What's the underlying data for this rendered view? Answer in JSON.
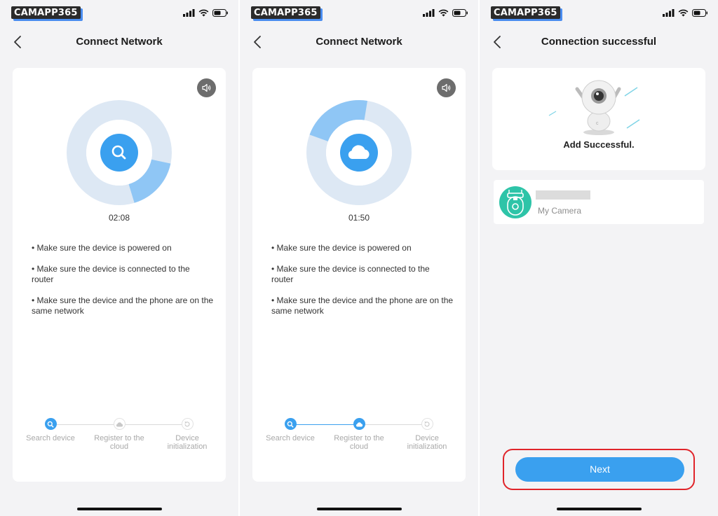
{
  "watermark": "CAMAPP365",
  "screen1": {
    "title": "Connect Network",
    "timer": "02:08",
    "center_icon": "search-icon",
    "progress_fraction": 0.17,
    "tips": [
      "• Make sure the device is powered on",
      "• Make sure the device is connected to the router",
      "• Make sure the device and the phone are on the same network"
    ],
    "steps": [
      {
        "label": "Search device",
        "icon": "search-icon",
        "state": "active"
      },
      {
        "label": "Register to the cloud",
        "icon": "cloud-icon",
        "state": "idle"
      },
      {
        "label": "Device initialization",
        "icon": "refresh-icon",
        "state": "idle"
      }
    ]
  },
  "screen2": {
    "title": "Connect Network",
    "timer": "01:50",
    "center_icon": "cloud-icon",
    "progress_fraction": 0.22,
    "tips": [
      "• Make sure the device is powered on",
      "• Make sure the device is connected to the router",
      "• Make sure the device and the phone are on the same network"
    ],
    "steps": [
      {
        "label": "Search device",
        "icon": "search-icon",
        "state": "active"
      },
      {
        "label": "Register to the cloud",
        "icon": "cloud-icon",
        "state": "active"
      },
      {
        "label": "Device initialization",
        "icon": "refresh-icon",
        "state": "idle"
      }
    ]
  },
  "screen3": {
    "title": "Connection successful",
    "message": "Add Successful.",
    "device_sub": "My Camera",
    "next_label": "Next"
  },
  "colors": {
    "accent": "#3aa0ef",
    "ring_light": "#dde8f4",
    "device_green": "#2ec4a8",
    "highlight_red": "#e0242a"
  }
}
